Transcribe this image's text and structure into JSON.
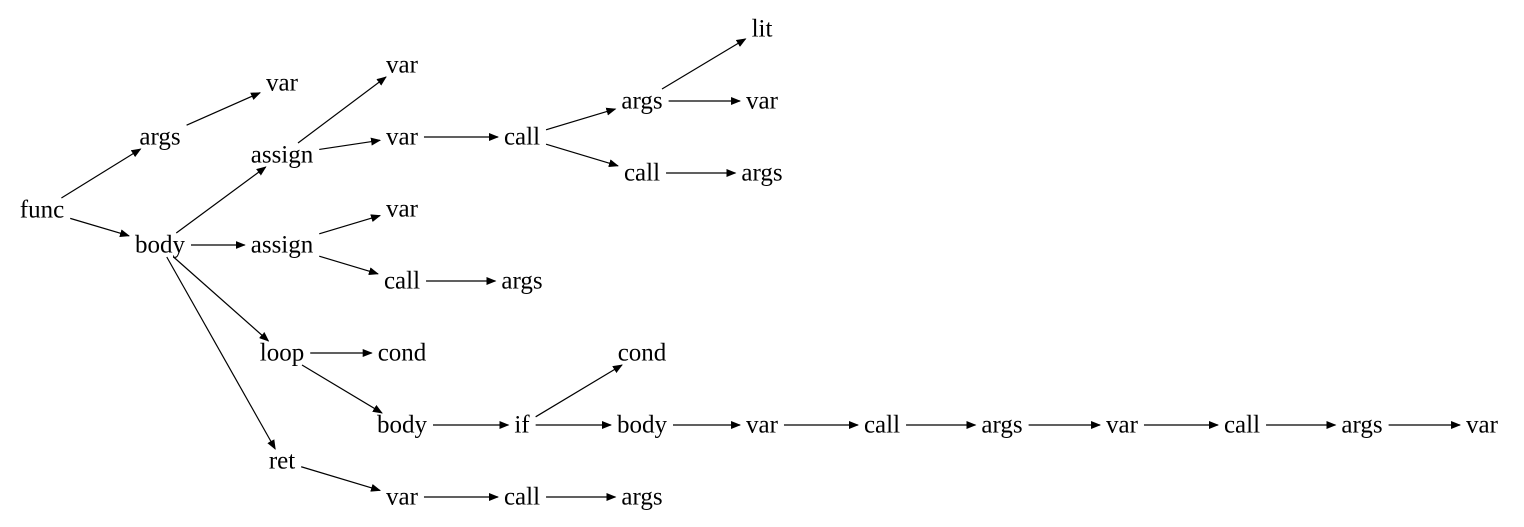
{
  "diagram": {
    "nodes": [
      {
        "id": "func",
        "label": "func"
      },
      {
        "id": "args1",
        "label": "args"
      },
      {
        "id": "body1",
        "label": "body"
      },
      {
        "id": "var_a",
        "label": "var"
      },
      {
        "id": "assign1",
        "label": "assign"
      },
      {
        "id": "assign2",
        "label": "assign"
      },
      {
        "id": "loop",
        "label": "loop"
      },
      {
        "id": "ret",
        "label": "ret"
      },
      {
        "id": "var_b",
        "label": "var"
      },
      {
        "id": "var_c",
        "label": "var"
      },
      {
        "id": "var_d",
        "label": "var"
      },
      {
        "id": "call_e",
        "label": "call"
      },
      {
        "id": "cond1",
        "label": "cond"
      },
      {
        "id": "body2",
        "label": "body"
      },
      {
        "id": "var_f",
        "label": "var"
      },
      {
        "id": "call_g",
        "label": "call"
      },
      {
        "id": "args_h",
        "label": "args"
      },
      {
        "id": "if",
        "label": "if"
      },
      {
        "id": "call_i",
        "label": "call"
      },
      {
        "id": "args_j",
        "label": "args"
      },
      {
        "id": "call_k",
        "label": "call"
      },
      {
        "id": "lit",
        "label": "lit"
      },
      {
        "id": "var_l",
        "label": "var"
      },
      {
        "id": "args_m",
        "label": "args"
      },
      {
        "id": "cond2",
        "label": "cond"
      },
      {
        "id": "body3",
        "label": "body"
      },
      {
        "id": "var_n",
        "label": "var"
      },
      {
        "id": "call_o",
        "label": "call"
      },
      {
        "id": "args_p",
        "label": "args"
      },
      {
        "id": "var_q",
        "label": "var"
      },
      {
        "id": "call_r",
        "label": "call"
      },
      {
        "id": "args_s",
        "label": "args"
      },
      {
        "id": "var_t",
        "label": "var"
      },
      {
        "id": "args_u",
        "label": "args"
      }
    ],
    "edges": [
      [
        "func",
        "args1"
      ],
      [
        "func",
        "body1"
      ],
      [
        "args1",
        "var_a"
      ],
      [
        "body1",
        "assign1"
      ],
      [
        "body1",
        "assign2"
      ],
      [
        "body1",
        "loop"
      ],
      [
        "body1",
        "ret"
      ],
      [
        "assign1",
        "var_b"
      ],
      [
        "assign1",
        "var_c"
      ],
      [
        "assign2",
        "var_d"
      ],
      [
        "assign2",
        "call_e"
      ],
      [
        "loop",
        "cond1"
      ],
      [
        "loop",
        "body2"
      ],
      [
        "ret",
        "var_f"
      ],
      [
        "var_c",
        "call_g"
      ],
      [
        "call_e",
        "args_h"
      ],
      [
        "body2",
        "if"
      ],
      [
        "var_f",
        "call_i"
      ],
      [
        "call_g",
        "args_j"
      ],
      [
        "call_g",
        "call_k"
      ],
      [
        "if",
        "cond2"
      ],
      [
        "if",
        "body3"
      ],
      [
        "call_i",
        "args_u"
      ],
      [
        "args_j",
        "lit"
      ],
      [
        "args_j",
        "var_l"
      ],
      [
        "call_k",
        "args_m"
      ],
      [
        "body3",
        "var_n"
      ],
      [
        "var_n",
        "call_o"
      ],
      [
        "call_o",
        "args_p"
      ],
      [
        "args_p",
        "var_q"
      ],
      [
        "var_q",
        "call_r"
      ],
      [
        "call_r",
        "args_s"
      ],
      [
        "args_s",
        "var_t"
      ]
    ]
  }
}
